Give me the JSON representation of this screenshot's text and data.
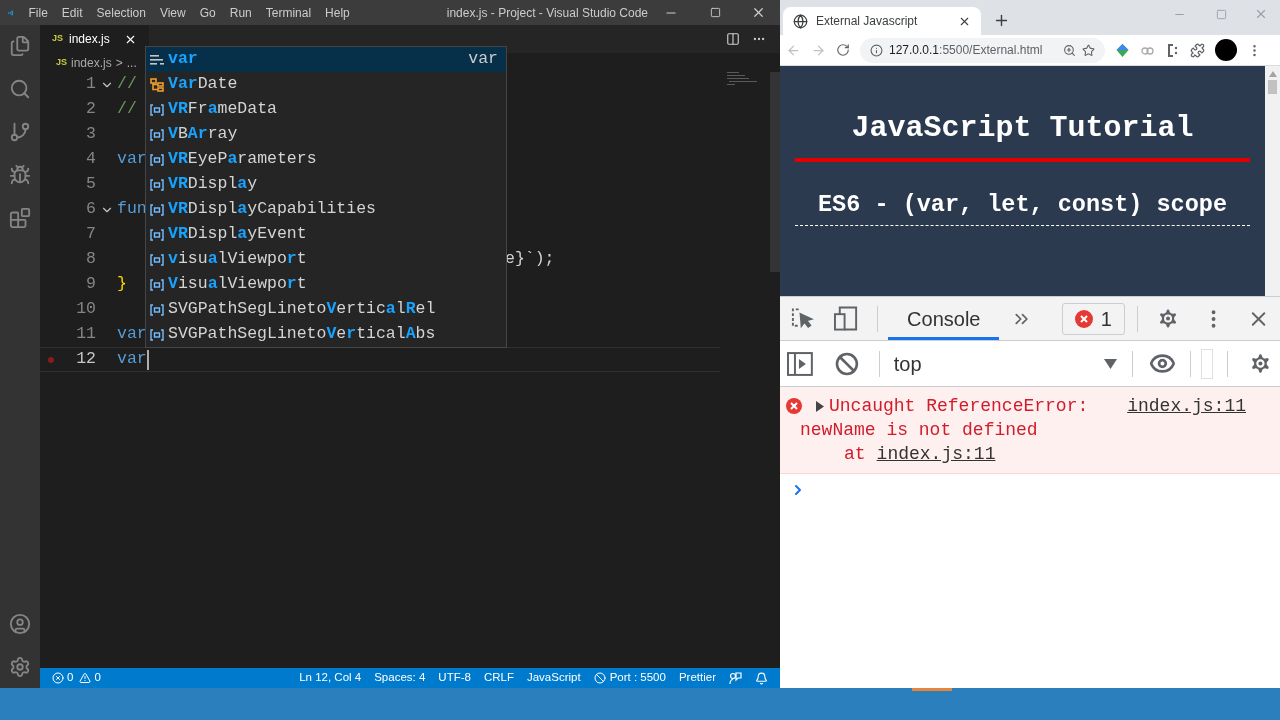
{
  "vscode": {
    "menu": [
      "File",
      "Edit",
      "Selection",
      "View",
      "Go",
      "Run",
      "Terminal",
      "Help"
    ],
    "title": "index.js - Project - Visual Studio Code",
    "tabs": [
      {
        "badge": "JS",
        "label": "index.js",
        "selected": true
      }
    ],
    "breadcrumb": {
      "badge": "JS",
      "file": "index.js",
      "separator": ">",
      "rest": "..."
    },
    "lines": [
      {
        "number": "1",
        "code": "//",
        "kind": "comment",
        "fold": true,
        "breakpoint": false,
        "current": false
      },
      {
        "number": "2",
        "code": "//",
        "kind": "comment",
        "fold": false,
        "breakpoint": false,
        "current": false
      },
      {
        "number": "3",
        "fold": false,
        "breakpoint": false,
        "current": false
      },
      {
        "number": "4",
        "code": "var",
        "kind": "keyword",
        "fold": false,
        "breakpoint": false,
        "current": false
      },
      {
        "number": "5",
        "fold": false,
        "breakpoint": false,
        "current": false
      },
      {
        "number": "6",
        "code": "fun",
        "kind": "keyword",
        "fold": true,
        "breakpoint": false,
        "current": false
      },
      {
        "number": "7",
        "fold": false,
        "breakpoint": false,
        "current": false
      },
      {
        "number": "8",
        "tail": "e}`);",
        "fold": false,
        "breakpoint": false,
        "current": false
      },
      {
        "number": "9",
        "code": "}",
        "kind": "brace",
        "fold": false,
        "breakpoint": false,
        "current": false
      },
      {
        "number": "10",
        "fold": false,
        "breakpoint": false,
        "current": false
      },
      {
        "number": "11",
        "code": "var",
        "kind": "keyword",
        "fold": false,
        "breakpoint": false,
        "current": false
      },
      {
        "number": "12",
        "code": "var",
        "kind": "keyword",
        "fold": false,
        "breakpoint": true,
        "current": true
      }
    ],
    "suggestions": [
      {
        "kind": "keyword",
        "selected": true,
        "detail": "var",
        "parts": [
          {
            "text": "var",
            "match": true
          }
        ]
      },
      {
        "kind": "class",
        "selected": false,
        "parts": [
          {
            "text": "Var",
            "match": true
          },
          {
            "text": "Date",
            "match": false
          }
        ]
      },
      {
        "kind": "variable",
        "selected": false,
        "parts": [
          {
            "text": "VR",
            "match": true
          },
          {
            "text": "Fr",
            "match": false
          },
          {
            "text": "a",
            "match": true
          },
          {
            "text": "meData",
            "match": false
          }
        ]
      },
      {
        "kind": "variable",
        "selected": false,
        "parts": [
          {
            "text": "V",
            "match": true
          },
          {
            "text": "B",
            "match": false
          },
          {
            "text": "Ar",
            "match": true
          },
          {
            "text": "ray",
            "match": false
          }
        ]
      },
      {
        "kind": "variable",
        "selected": false,
        "parts": [
          {
            "text": "VR",
            "match": true
          },
          {
            "text": "EyeP",
            "match": false
          },
          {
            "text": "a",
            "match": true
          },
          {
            "text": "rameters",
            "match": false
          }
        ]
      },
      {
        "kind": "variable",
        "selected": false,
        "parts": [
          {
            "text": "VR",
            "match": true
          },
          {
            "text": "Displ",
            "match": false
          },
          {
            "text": "a",
            "match": true
          },
          {
            "text": "y",
            "match": false
          }
        ]
      },
      {
        "kind": "variable",
        "selected": false,
        "parts": [
          {
            "text": "VR",
            "match": true
          },
          {
            "text": "Displ",
            "match": false
          },
          {
            "text": "a",
            "match": true
          },
          {
            "text": "yCapabilities",
            "match": false
          }
        ]
      },
      {
        "kind": "variable",
        "selected": false,
        "parts": [
          {
            "text": "VR",
            "match": true
          },
          {
            "text": "Displ",
            "match": false
          },
          {
            "text": "a",
            "match": true
          },
          {
            "text": "yEvent",
            "match": false
          }
        ]
      },
      {
        "kind": "variable",
        "selected": false,
        "parts": [
          {
            "text": "v",
            "match": true
          },
          {
            "text": "isu",
            "match": false
          },
          {
            "text": "a",
            "match": true
          },
          {
            "text": "lViewpo",
            "match": false
          },
          {
            "text": "r",
            "match": true
          },
          {
            "text": "t",
            "match": false
          }
        ]
      },
      {
        "kind": "variable",
        "selected": false,
        "parts": [
          {
            "text": "V",
            "match": true
          },
          {
            "text": "isu",
            "match": false
          },
          {
            "text": "a",
            "match": true
          },
          {
            "text": "lViewpo",
            "match": false
          },
          {
            "text": "r",
            "match": true
          },
          {
            "text": "t",
            "match": false
          }
        ]
      },
      {
        "kind": "variable",
        "selected": false,
        "parts": [
          {
            "text": "SVGPathSegLineto",
            "match": false
          },
          {
            "text": "V",
            "match": true
          },
          {
            "text": "ertic",
            "match": false
          },
          {
            "text": "a",
            "match": true
          },
          {
            "text": "l",
            "match": false
          },
          {
            "text": "R",
            "match": true
          },
          {
            "text": "el",
            "match": false
          }
        ]
      },
      {
        "kind": "variable",
        "selected": false,
        "parts": [
          {
            "text": "SVGPathSegLineto",
            "match": false
          },
          {
            "text": "V",
            "match": true
          },
          {
            "text": "e",
            "match": false
          },
          {
            "text": "r",
            "match": true
          },
          {
            "text": "tical",
            "match": false
          },
          {
            "text": "A",
            "match": true
          },
          {
            "text": "bs",
            "match": false
          }
        ]
      }
    ],
    "status_bar": {
      "errors": "0",
      "warnings": "0",
      "items": [
        "Ln 12, Col 4",
        "Spaces: 4",
        "UTF-8",
        "CRLF",
        "JavaScript"
      ],
      "port": "Port : 5500",
      "formatter": "Prettier"
    }
  },
  "browser": {
    "tab": {
      "title": "External Javascript"
    },
    "url": {
      "host": "127.0.0.1",
      "path": ":5500/External.html"
    },
    "page": {
      "heading": "JavaScript Tutorial",
      "subheading": "ES6 - (var, let, const) scope"
    },
    "devtools": {
      "tabs": [
        {
          "label": "Console",
          "selected": true
        }
      ],
      "error_count": "1",
      "context": "top",
      "messages": [
        {
          "kind": "error",
          "text": "Uncaught ReferenceError:",
          "link": "index.js:11",
          "detail": "newName is not defined",
          "at": "at",
          "at_link": "index.js:11"
        }
      ]
    }
  }
}
